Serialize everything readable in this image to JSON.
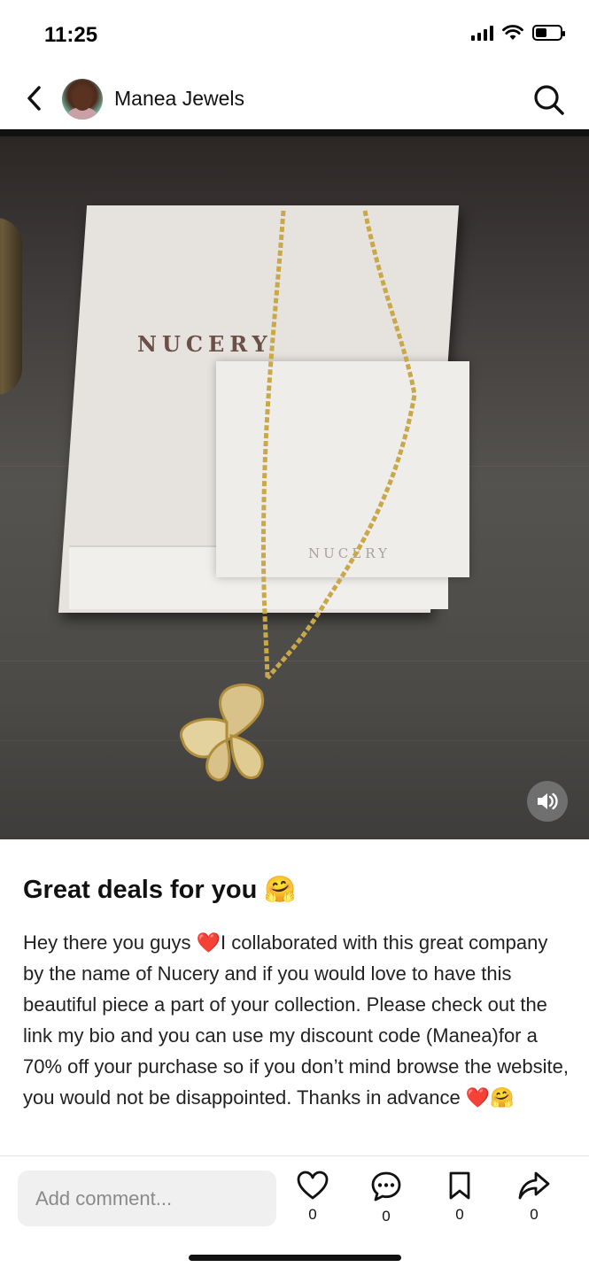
{
  "status_bar": {
    "time": "11:25",
    "icons": [
      "cellular-signal-icon",
      "wifi-icon",
      "battery-icon"
    ],
    "battery_level": 0.45
  },
  "header": {
    "back_icon": "chevron-left-icon",
    "username": "Manea Jewels",
    "search_icon": "search-icon"
  },
  "photo": {
    "box_brand": "NUCERY",
    "card_brand": "NUCERY",
    "volume_icon": "speaker-icon"
  },
  "post": {
    "title": "Great deals for you 🤗",
    "body": "Hey there you guys ❤️I collaborated with this great company by the name of Nucery and if you would love to have this beautiful piece  a part of your collection. Please check out the link my bio and you can use my discount code (Manea)for a 70% off your purchase so if you don’t mind browse the website, you would not be disappointed. Thanks in advance ❤️🤗"
  },
  "actions": {
    "comment_placeholder": "Add comment...",
    "like": {
      "icon": "heart-icon",
      "count": "0"
    },
    "comment": {
      "icon": "comment-bubble-icon",
      "count": "0"
    },
    "save": {
      "icon": "bookmark-icon",
      "count": "0"
    },
    "share": {
      "icon": "share-arrow-icon",
      "count": "0"
    }
  },
  "colors": {
    "text": "#111111",
    "input_bg": "#f0f0f0",
    "heart_red": "#d6102b"
  }
}
